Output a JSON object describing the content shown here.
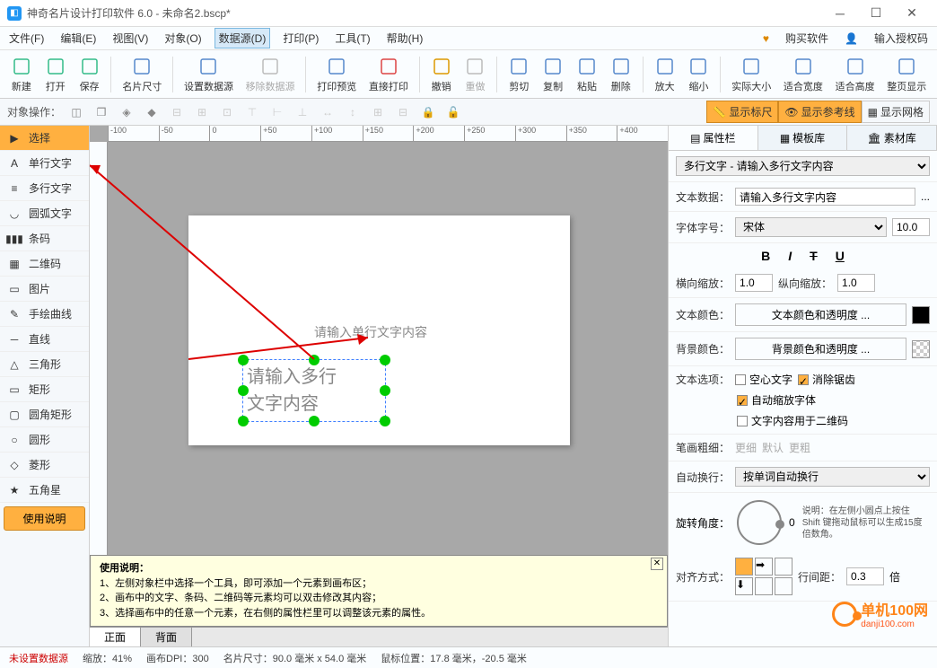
{
  "title": "神奇名片设计打印软件 6.0 - 未命名2.bscp*",
  "menu": [
    "文件(F)",
    "编辑(E)",
    "视图(V)",
    "对象(O)",
    "数据源(D)",
    "打印(P)",
    "工具(T)",
    "帮助(H)"
  ],
  "menu_active": 4,
  "topright": {
    "buy": "购买软件",
    "auth": "输入授权码"
  },
  "toolbar": [
    {
      "id": "new",
      "label": "新建",
      "color": "#3b8"
    },
    {
      "id": "open",
      "label": "打开",
      "color": "#3b8"
    },
    {
      "id": "save",
      "label": "保存",
      "color": "#3b8"
    },
    {
      "id": "cardsize",
      "label": "名片尺寸",
      "color": "#58c"
    },
    {
      "id": "setds",
      "label": "设置数据源",
      "color": "#58c"
    },
    {
      "id": "rmds",
      "label": "移除数据源",
      "disabled": true
    },
    {
      "id": "preview",
      "label": "打印预览",
      "color": "#58c"
    },
    {
      "id": "print",
      "label": "直接打印",
      "color": "#d44"
    },
    {
      "id": "undo",
      "label": "撤销",
      "color": "#d90"
    },
    {
      "id": "redo",
      "label": "重做",
      "disabled": true
    },
    {
      "id": "cut",
      "label": "剪切",
      "color": "#58c"
    },
    {
      "id": "copy",
      "label": "复制",
      "color": "#58c"
    },
    {
      "id": "paste",
      "label": "粘贴",
      "color": "#58c"
    },
    {
      "id": "delete",
      "label": "删除",
      "color": "#58c"
    },
    {
      "id": "zoomin",
      "label": "放大",
      "color": "#58c"
    },
    {
      "id": "zoomout",
      "label": "缩小",
      "color": "#58c"
    },
    {
      "id": "actual",
      "label": "实际大小",
      "color": "#58c"
    },
    {
      "id": "fitw",
      "label": "适合宽度",
      "color": "#58c"
    },
    {
      "id": "fith",
      "label": "适合高度",
      "color": "#58c"
    },
    {
      "id": "fitall",
      "label": "整页显示",
      "color": "#58c"
    }
  ],
  "objbar_label": "对象操作：",
  "toggles": {
    "ruler": "显示标尺",
    "guides": "显示参考线",
    "grid": "显示网格"
  },
  "tools": [
    {
      "id": "select",
      "label": "选择",
      "icon": "▶"
    },
    {
      "id": "singletext",
      "label": "单行文字",
      "icon": "A"
    },
    {
      "id": "multitext",
      "label": "多行文字",
      "icon": "≡"
    },
    {
      "id": "arctext",
      "label": "圆弧文字",
      "icon": "◡"
    },
    {
      "id": "barcode",
      "label": "条码",
      "icon": "▮▮▮"
    },
    {
      "id": "qrcode",
      "label": "二维码",
      "icon": "▦"
    },
    {
      "id": "image",
      "label": "图片",
      "icon": "▭"
    },
    {
      "id": "freehand",
      "label": "手绘曲线",
      "icon": "✎"
    },
    {
      "id": "line",
      "label": "直线",
      "icon": "─"
    },
    {
      "id": "triangle",
      "label": "三角形",
      "icon": "△"
    },
    {
      "id": "rect",
      "label": "矩形",
      "icon": "▭"
    },
    {
      "id": "roundrect",
      "label": "圆角矩形",
      "icon": "▢"
    },
    {
      "id": "circle",
      "label": "圆形",
      "icon": "○"
    },
    {
      "id": "diamond",
      "label": "菱形",
      "icon": "◇"
    },
    {
      "id": "star",
      "label": "五角星",
      "icon": "★"
    }
  ],
  "help_button": "使用说明",
  "canvas": {
    "single_text": "请输入单行文字内容",
    "multi_text": "请输入多行\n文字内容"
  },
  "ruler_marks": [
    "-100",
    "-50",
    "0",
    "+50",
    "+100",
    "+150",
    "+200",
    "+250",
    "+300",
    "+350",
    "+400"
  ],
  "help": {
    "title": "使用说明：",
    "line1": "1、左侧对象栏中选择一个工具，即可添加一个元素到画布区；",
    "line2": "2、画布中的文字、条码、二维码等元素均可以双击修改其内容；",
    "line3": "3、选择画布中的任意一个元素，在右侧的属性栏里可以调整该元素的属性。"
  },
  "tabs": {
    "front": "正面",
    "back": "背面"
  },
  "rpanel": {
    "tabs": [
      "属性栏",
      "模板库",
      "素材库"
    ],
    "object_type": "多行文字 - 请输入多行文字内容",
    "text_data_label": "文本数据：",
    "text_data": "请输入多行文字内容",
    "font_label": "字体字号：",
    "font": "宋体",
    "size": "10.0",
    "hscale_label": "横向缩放：",
    "hscale": "1.0",
    "vscale_label": "纵向缩放：",
    "vscale": "1.0",
    "textcolor_label": "文本颜色：",
    "textcolor_btn": "文本颜色和透明度 ...",
    "bgcolor_label": "背景颜色：",
    "bgcolor_btn": "背景颜色和透明度 ...",
    "options_label": "文本选项：",
    "hollow": "空心文字",
    "antialias": "消除锯齿",
    "autoscale": "自动缩放字体",
    "qrcontent": "文字内容用于二维码",
    "penwidth_label": "笔画粗细：",
    "pen_thin": "更细",
    "pen_default": "默认",
    "pen_thick": "更粗",
    "wrap_label": "自动换行：",
    "wrap": "按单词自动换行",
    "rotate_label": "旋转角度：",
    "rotate_val": "0",
    "rotate_help": "说明：在左侧小圆点上按住 Shift 键拖动鼠标可以生成15度倍数角。",
    "linespace_label": "行间距：",
    "linespace": "0.3",
    "linespace_unit": "倍",
    "align_label": "对齐方式："
  },
  "status": {
    "ds": "未设置数据源",
    "zoom": "缩放：41%",
    "dpi": "画布DPI：300",
    "size": "名片尺寸：90.0 毫米 x 54.0 毫米",
    "mouse": "鼠标位置：17.8 毫米，-20.5 毫米"
  },
  "watermark": {
    "text": "单机100网",
    "url": "danji100.com"
  }
}
